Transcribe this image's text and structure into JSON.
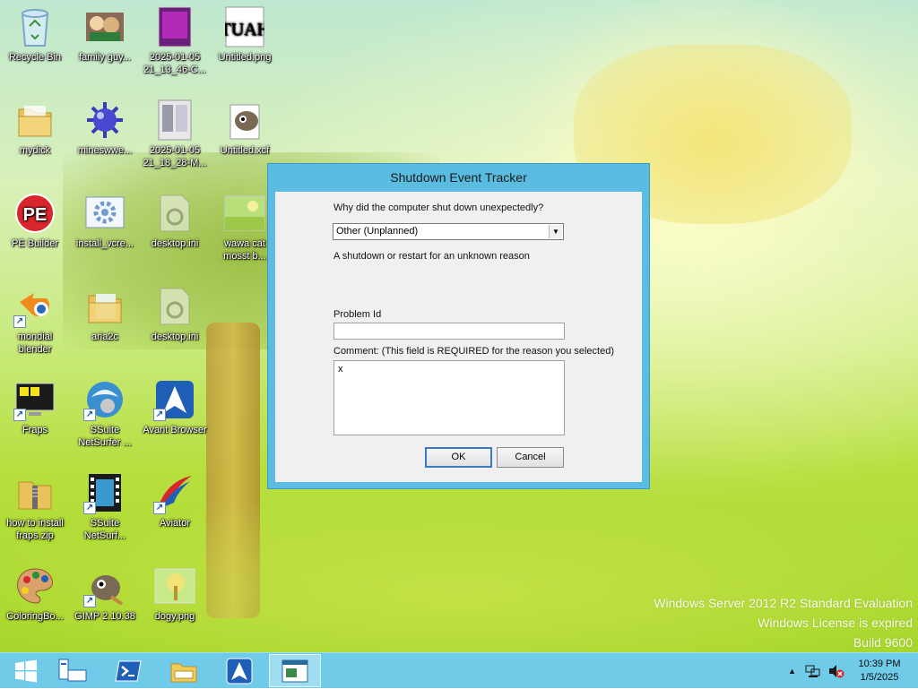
{
  "desktop": {
    "icons": [
      {
        "label": "Recycle Bin",
        "icon": "recycle-bin-icon"
      },
      {
        "label": "family guy...",
        "icon": "image-file-icon"
      },
      {
        "label": "2025-01-05 21_13_46-C...",
        "icon": "screenshot-icon"
      },
      {
        "label": "Untitled.png",
        "icon": "png-file-icon"
      },
      {
        "label": "mydick",
        "icon": "folder-icon"
      },
      {
        "label": "mineswwe...",
        "icon": "minesweeper-icon"
      },
      {
        "label": "2025-01-05 21_18_28-M...",
        "icon": "screenshot-icon"
      },
      {
        "label": "Untitled.xcf",
        "icon": "gimp-file-icon"
      },
      {
        "label": "PE Builder",
        "icon": "pe-builder-icon"
      },
      {
        "label": "install_vcre...",
        "icon": "installer-icon"
      },
      {
        "label": "desktop.ini",
        "icon": "ini-file-icon"
      },
      {
        "label": "wawa cat mosst b...",
        "icon": "image-file-icon"
      },
      {
        "label": "mondial blender",
        "icon": "blender-icon"
      },
      {
        "label": "aria2c",
        "icon": "folder-icon"
      },
      {
        "label": "desktop.ini",
        "icon": "ini-file-icon"
      },
      {
        "label": "Fraps",
        "icon": "fraps-icon"
      },
      {
        "label": "SSuite NetSurfer ...",
        "icon": "browser-icon"
      },
      {
        "label": "Avant Browser",
        "icon": "avant-browser-icon"
      },
      {
        "label": "how to install fraps.zip",
        "icon": "zip-folder-icon"
      },
      {
        "label": "SSuite NetSurf...",
        "icon": "film-icon"
      },
      {
        "label": "Aviator",
        "icon": "aviator-icon"
      },
      {
        "label": "ColoringBo...",
        "icon": "palette-icon"
      },
      {
        "label": "GIMP 2.10.38",
        "icon": "gimp-icon"
      },
      {
        "label": "dogy.png",
        "icon": "image-file-icon"
      }
    ],
    "watermark": {
      "line1": "Windows Server 2012 R2 Standard Evaluation",
      "line2": "Windows License is expired",
      "line3": "Build 9600"
    }
  },
  "dialog": {
    "title": "Shutdown Event Tracker",
    "question": "Why did the computer shut down unexpectedly?",
    "reason_selected": "Other (Unplanned)",
    "reason_description": "A shutdown or restart for an unknown reason",
    "problem_id_label": "Problem Id",
    "problem_id_value": "",
    "comment_label": "Comment: (This field is REQUIRED for the reason you selected)",
    "comment_value": "x",
    "ok_label": "OK",
    "cancel_label": "Cancel"
  },
  "taskbar": {
    "clock_time": "10:39 PM",
    "clock_date": "1/5/2025",
    "accent": "#6fcbe8"
  }
}
